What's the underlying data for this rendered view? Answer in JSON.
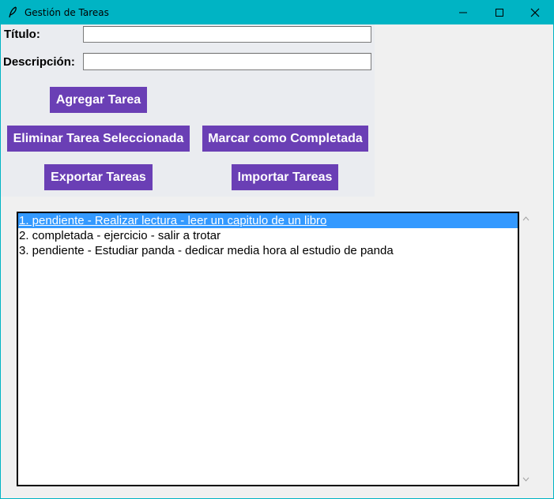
{
  "window": {
    "title": "Gestión de Tareas",
    "app_icon": "feather-icon",
    "controls": [
      "minimize-icon",
      "maximize-icon",
      "close-icon"
    ]
  },
  "form": {
    "titulo_label": "Título:",
    "titulo_value": "",
    "descripcion_label": "Descripción:",
    "descripcion_value": ""
  },
  "buttons": {
    "agregar": "Agregar Tarea",
    "eliminar": "Eliminar Tarea Seleccionada",
    "marcar": "Marcar como Completada",
    "exportar": "Exportar Tareas",
    "importar": "Importar Tareas"
  },
  "tasks": [
    "1. pendiente - Realizar lectura - leer un capitulo de un libro",
    "2. completada - ejercicio - salir a trotar",
    "3. pendiente - Estudiar panda - dedicar media hora al estudio de panda"
  ],
  "selected_index": 0,
  "colors": {
    "titlebar": "#00b4c4",
    "button": "#6a3fb5",
    "selection": "#3399ff"
  }
}
